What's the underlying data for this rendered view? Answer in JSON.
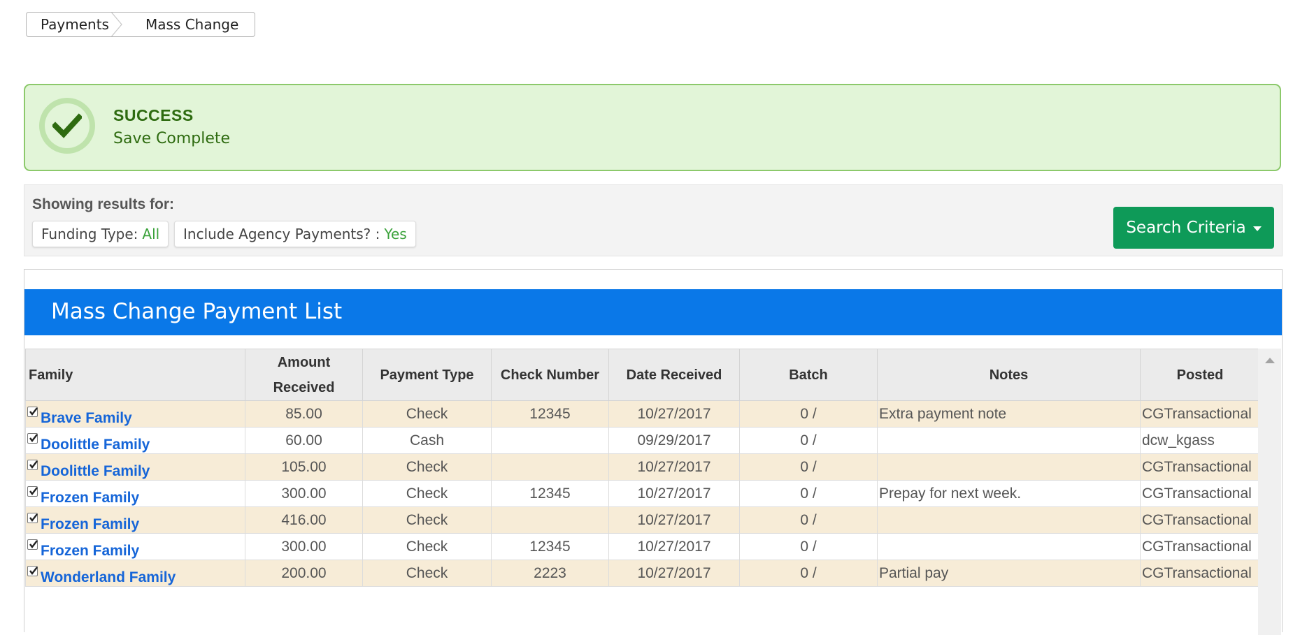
{
  "breadcrumb": {
    "items": [
      "Payments",
      "Mass Change"
    ]
  },
  "alert": {
    "title": "SUCCESS",
    "message": "Save Complete",
    "icon": "check-icon",
    "color": "#2e6b10"
  },
  "filters": {
    "heading": "Showing results for:",
    "chips": [
      {
        "label": "Funding Type:",
        "value": "All"
      },
      {
        "label": "Include Agency Payments? :",
        "value": "Yes"
      }
    ],
    "search_button": "Search Criteria",
    "search_button_color": "#0e9a58"
  },
  "panel": {
    "title": "Mass Change Payment List",
    "header_color": "#0a78e8"
  },
  "table": {
    "columns": [
      "Family",
      "Amount Received",
      "Payment Type",
      "Check Number",
      "Date Received",
      "Batch",
      "Notes",
      "Posted"
    ],
    "rows": [
      {
        "checked": true,
        "family": "Brave Family",
        "amount": "85.00",
        "type": "Check",
        "check": "12345",
        "date": "10/27/2017",
        "batch": "0 /",
        "notes": "Extra payment note",
        "posted": "CGTransactional"
      },
      {
        "checked": true,
        "family": "Doolittle Family",
        "amount": "60.00",
        "type": "Cash",
        "check": "",
        "date": "09/29/2017",
        "batch": "0 /",
        "notes": "",
        "posted": "dcw_kgass"
      },
      {
        "checked": true,
        "family": "Doolittle Family",
        "amount": "105.00",
        "type": "Check",
        "check": "",
        "date": "10/27/2017",
        "batch": "0 /",
        "notes": "",
        "posted": "CGTransactional"
      },
      {
        "checked": true,
        "family": "Frozen Family",
        "amount": "300.00",
        "type": "Check",
        "check": "12345",
        "date": "10/27/2017",
        "batch": "0 /",
        "notes": "Prepay for next week.",
        "posted": "CGTransactional"
      },
      {
        "checked": true,
        "family": "Frozen Family",
        "amount": "416.00",
        "type": "Check",
        "check": "",
        "date": "10/27/2017",
        "batch": "0 /",
        "notes": "",
        "posted": "CGTransactional"
      },
      {
        "checked": true,
        "family": "Frozen Family",
        "amount": "300.00",
        "type": "Check",
        "check": "12345",
        "date": "10/27/2017",
        "batch": "0 /",
        "notes": "",
        "posted": "CGTransactional"
      },
      {
        "checked": true,
        "family": "Wonderland Family",
        "amount": "200.00",
        "type": "Check",
        "check": "2223",
        "date": "10/27/2017",
        "batch": "0 /",
        "notes": "Partial pay",
        "posted": "CGTransactional"
      }
    ]
  }
}
